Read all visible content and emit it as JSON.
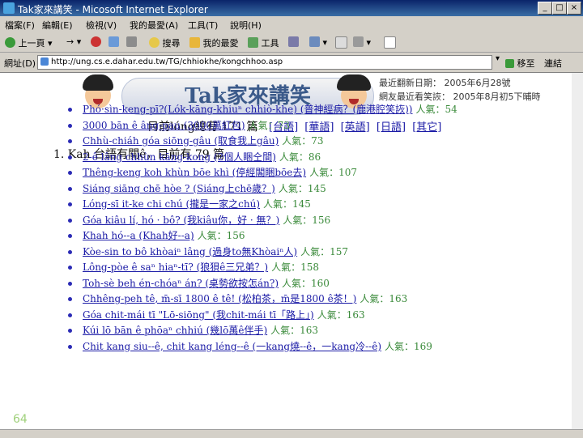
{
  "window": {
    "title": "Tak家來講笑 - Micosoft Internet Explorer",
    "min": "_",
    "max": "□",
    "close": "×"
  },
  "menu": [
    "檔案(F)",
    "編輯(E)",
    "檢視(V)",
    "我的最愛(A)",
    "工具(T)",
    "說明(H)"
  ],
  "toolbar": {
    "back": "上一頁",
    "search": "搜尋",
    "favorites": "我的最愛",
    "tools": "工具"
  },
  "address": {
    "label": "網址(D)",
    "url": "http://ung.cs.e.dahar.edu.tw/TG/chhiokhe/kongchhoo.asp",
    "go": "移至",
    "links": "連結"
  },
  "banner": {
    "title": "Tak家來講笑"
  },
  "update": {
    "line1": "最近翻新日期： 2005年6月28號",
    "line2": "網友最近看笑詼： 2005年8月初5下晡時"
  },
  "summary": {
    "text": "目前lóng總有 171 篇"
  },
  "langs": [
    "[台語]",
    "[華語]",
    "[英語]",
    "[日語]",
    "[其它]"
  ],
  "section": {
    "title": "1. Kah 台語有關ê，目前有 79 篇"
  },
  "items": [
    {
      "title": "Phó·sìn-keng-pī?(Lók-kāng-khiuⁿ chhiò-khe) (普神經病？(鹿港腔笑詼))",
      "pop": "人氣：54"
    },
    {
      "title": "3000 bān ê âng-pau (3000萬紅包)",
      "pop": "人氣：73"
    },
    {
      "title": "Chhù-chiáh góa siōng-gâu (取食我上gâu)",
      "pop": "人氣：73"
    },
    {
      "title": "2-ê lâng chhùn kāng-kong (2個人睏仝間)",
      "pop": "人氣：86"
    },
    {
      "title": "Thêng-keng koh khùn bōe khì (停經閣睏bōe去)",
      "pop": "人氣：107"
    },
    {
      "title": "Siáng siāng chē hòe ? (Siáng上chē歲？)",
      "pop": "人氣：145"
    },
    {
      "title": "Lóng-sī it-ke chi chú (攏是一家之chú)",
      "pop": "人氣：145"
    },
    {
      "title": "Góa kiâu lí, hó · bô? (我kiâu你，好 · 無？)",
      "pop": "人氣：156"
    },
    {
      "title": "Khah hó--a (Khah好--a)",
      "pop": "人氣：156"
    },
    {
      "title": "Kòe-sin to bô khòaiⁿ lâng (過身to無Khòaiⁿ人)",
      "pop": "人氣：157"
    },
    {
      "title": "Lông-pòe ê saⁿ hiaⁿ-tī? (狼狽ê三兄弟？)",
      "pop": "人氣：158"
    },
    {
      "title": "Toh-sè beh én-chóaⁿ án? (桌勢欲按怎án?)",
      "pop": "人氣：160"
    },
    {
      "title": "Chhêng-peh tê, m̄-sī 1800 ê tê! (松柏茶，m̄是1800 ê茶！)",
      "pop": "人氣：163"
    },
    {
      "title": "Góa chit-mái tī \"Lō-siōng\" (我chit-mái tī「路上」)",
      "pop": "人氣：163"
    },
    {
      "title": "Kúi lō bān ê phōaⁿ chhiú (幾lō萬ê伴手)",
      "pop": "人氣：163"
    },
    {
      "title": "Chit kang siu--ê, chit kang léng--ê (一kang燒--ê，一kang冷--ê)",
      "pop": "人氣：169"
    }
  ],
  "page": {
    "number": "64"
  },
  "colors": {
    "link": "#1a1aa6",
    "popularity": "#3a8a3a",
    "chrome": "#d4d0c8"
  }
}
